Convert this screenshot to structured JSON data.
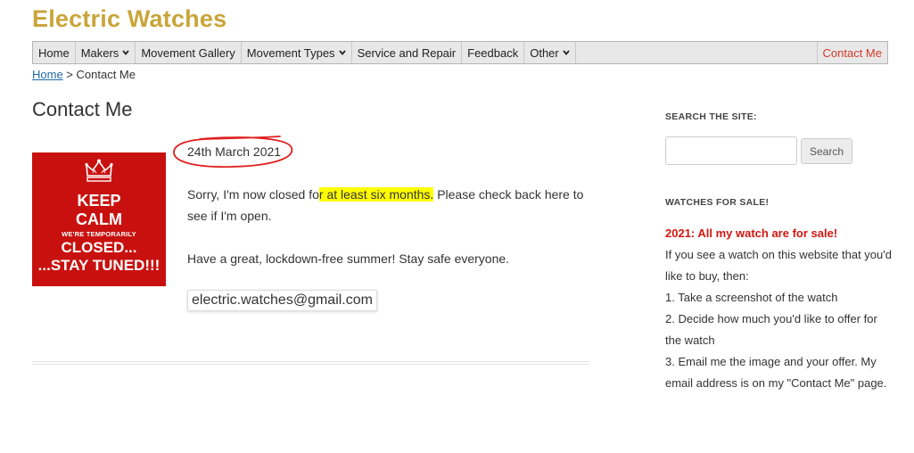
{
  "site": {
    "title": "Electric Watches"
  },
  "nav": {
    "items": [
      {
        "label": "Home",
        "dropdown": false
      },
      {
        "label": "Makers",
        "dropdown": true
      },
      {
        "label": "Movement Gallery",
        "dropdown": false
      },
      {
        "label": "Movement Types",
        "dropdown": true
      },
      {
        "label": "Service and Repair",
        "dropdown": false
      },
      {
        "label": "Feedback",
        "dropdown": false
      },
      {
        "label": "Other",
        "dropdown": true
      }
    ],
    "contact_label": "Contact Me",
    "accent_color": "#d23a2a"
  },
  "breadcrumb": {
    "home": "Home",
    "separator": " > ",
    "current": "Contact Me"
  },
  "page": {
    "title": "Contact Me",
    "image": {
      "line1": "KEEP",
      "line2": "CALM",
      "line3": "WE'RE TEMPORARILY",
      "line4": "CLOSED...",
      "line5": "...STAY TUNED!!!",
      "icon": "crown-icon",
      "bg_color": "#c8110f"
    },
    "date": "24th March 2021",
    "para1_before": "Sorry, I'm now closed fo",
    "para1_highlight": "r at least six months.",
    "para1_after": " Please check back here to see if I'm open.",
    "para2": "Have a great, lockdown-free summer! Stay safe everyone.",
    "email": "electric.watches@gmail.com"
  },
  "sidebar": {
    "search_title": "SEARCH THE SITE:",
    "search_placeholder": "",
    "search_button": "Search",
    "watches_title": "WATCHES FOR SALE!",
    "sale_heading": "2021: All my watch are for sale!",
    "sale_lines": [
      "If you see a watch on this website that you'd like to buy, then:",
      "1. Take a screenshot of the watch",
      "2. Decide how much you'd like to offer for the watch",
      "3. Email me the image and your offer. My email address is on my \"Contact Me\" page."
    ]
  },
  "colors": {
    "title_gold": "#c9a53a",
    "sale_red": "#d2160f",
    "highlight": "#ffff00",
    "annotation_red": "#e02020"
  }
}
